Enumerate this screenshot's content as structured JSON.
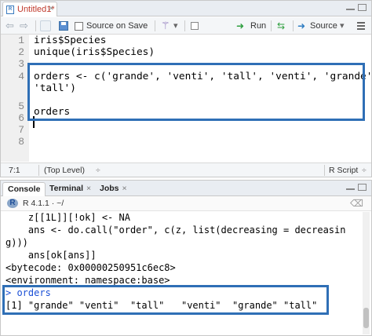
{
  "editor": {
    "tab": {
      "label": "Untitled1*",
      "close": "×"
    },
    "toolbar": {
      "back": "⇦",
      "forward": "⇨",
      "source_on_save": "Source on Save",
      "run": "Run",
      "source": "Source",
      "dropdown": "▾"
    },
    "line_numbers": [
      "1",
      "2",
      "3",
      "4",
      "5",
      "6",
      "7",
      "8"
    ],
    "lines": [
      "iris$Species",
      "unique(iris$Species)",
      "",
      "orders <- c('grande', 'venti', 'tall', 'venti', 'grande',",
      "'tall')",
      "orders",
      "",
      ""
    ],
    "status": {
      "position": "7:1",
      "scope": "(Top Level)",
      "scope_arrow": "÷",
      "filetype": "R Script",
      "filetype_arrow": "÷"
    }
  },
  "console": {
    "tabs": [
      {
        "label": "Console",
        "close": ""
      },
      {
        "label": "Terminal",
        "close": "×"
      },
      {
        "label": "Jobs",
        "close": "×"
      }
    ],
    "r_version": "R 4.1.1 · ~/",
    "lines": [
      "    z[[1L]][!ok] <- NA",
      "    ans <- do.call(\"order\", c(z, list(decreasing = decreasin",
      "g)))",
      "    ans[ok[ans]]",
      "<bytecode: 0x00000250951c6ec8>",
      "<environment: namespace:base>",
      "> orders",
      "[1] \"grande\" \"venti\"  \"tall\"   \"venti\"  \"grande\" \"tall\""
    ]
  },
  "colors": {
    "highlight": "#2f6fb6",
    "tab_modified": "#c0392b",
    "console_input": "#1a4fd6"
  }
}
